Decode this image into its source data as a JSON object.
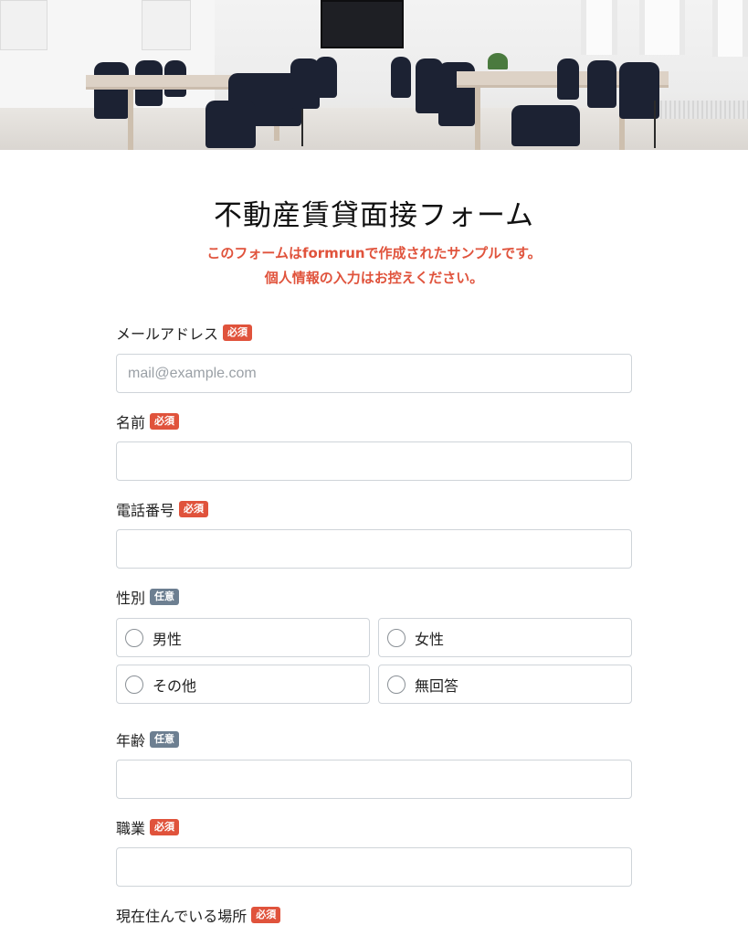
{
  "form": {
    "title": "不動産賃貸面接フォーム",
    "notice_line1": "このフォームはformrunで作成されたサンプルです。",
    "notice_line2": "個人情報の入力はお控えください。"
  },
  "badges": {
    "required": "必須",
    "optional": "任意"
  },
  "fields": {
    "email": {
      "label": "メールアドレス",
      "placeholder": "mail@example.com",
      "value": ""
    },
    "name": {
      "label": "名前",
      "value": ""
    },
    "phone": {
      "label": "電話番号",
      "value": ""
    },
    "gender": {
      "label": "性別",
      "options": [
        "男性",
        "女性",
        "その他",
        "無回答"
      ]
    },
    "age": {
      "label": "年齢",
      "value": ""
    },
    "occupation": {
      "label": "職業",
      "value": ""
    },
    "residence": {
      "label": "現在住んでいる場所"
    }
  },
  "colors": {
    "required_badge": "#e0533c",
    "optional_badge": "#6d7f91",
    "notice_text": "#e0533c",
    "input_border": "#cfd4d9"
  }
}
